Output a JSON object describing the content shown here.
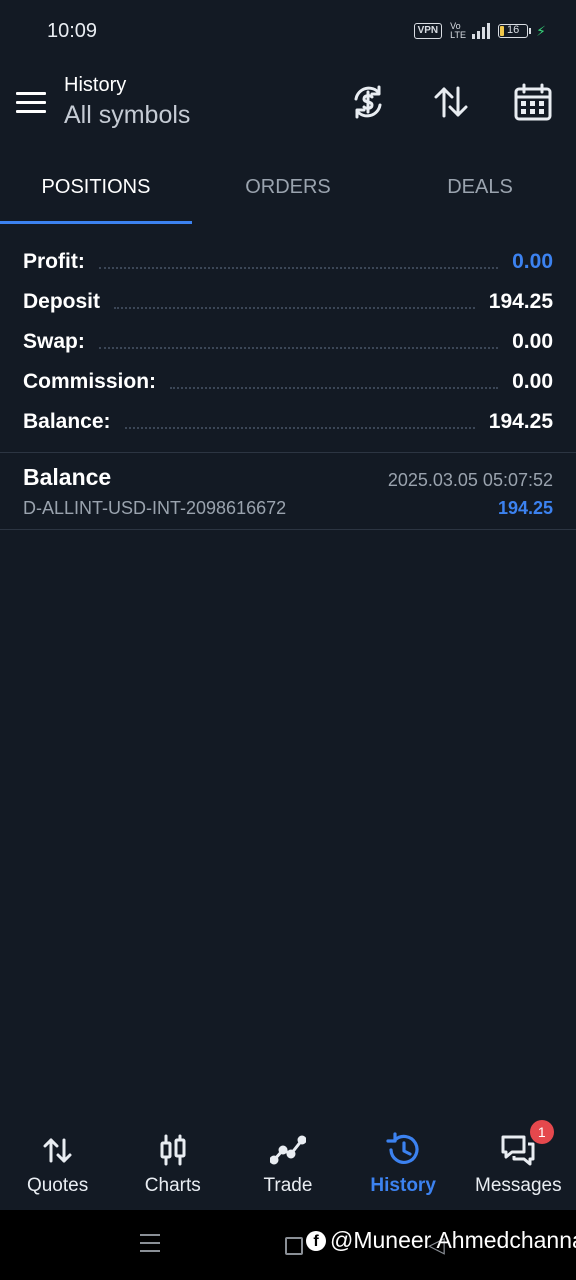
{
  "status_bar": {
    "time": "10:09",
    "vpn": "VPN",
    "volte": "Vo LTE",
    "network": "4G",
    "battery_level": "16"
  },
  "header": {
    "title": "History",
    "subtitle": "All symbols",
    "icons": [
      "currency-exchange-icon",
      "sort-icon",
      "calendar-icon"
    ]
  },
  "tabs": [
    {
      "label": "POSITIONS",
      "active": true
    },
    {
      "label": "ORDERS",
      "active": false
    },
    {
      "label": "DEALS",
      "active": false
    }
  ],
  "summary": [
    {
      "label": "Profit:",
      "value": "0.00",
      "highlight": true
    },
    {
      "label": "Deposit",
      "value": "194.25",
      "highlight": false
    },
    {
      "label": "Swap:",
      "value": "0.00",
      "highlight": false
    },
    {
      "label": "Commission:",
      "value": "0.00",
      "highlight": false
    },
    {
      "label": "Balance:",
      "value": "194.25",
      "highlight": false
    }
  ],
  "deal": {
    "type": "Balance",
    "time": "2025.03.05 05:07:52",
    "comment": "D-ALLINT-USD-INT-2098616672",
    "amount": "194.25"
  },
  "bottom_nav": [
    {
      "label": "Quotes",
      "icon": "quotes-icon",
      "active": false
    },
    {
      "label": "Charts",
      "icon": "candlestick-icon",
      "active": false
    },
    {
      "label": "Trade",
      "icon": "trade-line-icon",
      "active": false
    },
    {
      "label": "History",
      "icon": "history-icon",
      "active": true
    },
    {
      "label": "Messages",
      "icon": "messages-icon",
      "active": false,
      "badge": "1"
    }
  ],
  "watermark": "@Muneer Ahmedchanna",
  "colors": {
    "background": "#131a24",
    "accent": "#3c82f0",
    "muted": "#9aa3ae",
    "badge": "#e5484d"
  }
}
